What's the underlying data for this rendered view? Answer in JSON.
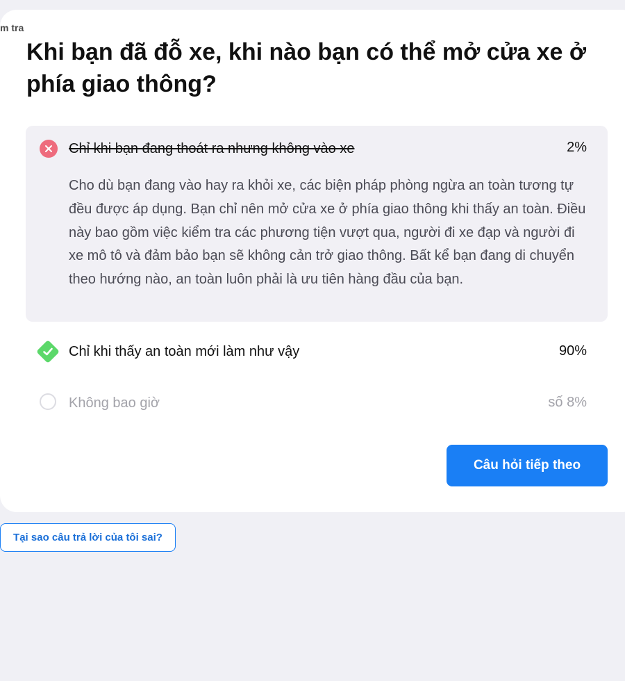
{
  "header": {
    "corner_label": "m tra"
  },
  "question": {
    "text": "Khi bạn đã đỗ xe, khi nào bạn có thể mở cửa xe ở phía giao thông?"
  },
  "answers": [
    {
      "status": "wrong",
      "icon": "x-circle-icon",
      "text": "Chỉ khi bạn đang thoát ra nhưng không vào xe",
      "percent": "2%",
      "explanation": "Cho dù bạn đang vào hay ra khỏi xe, các biện pháp phòng ngừa an toàn tương tự đều được áp dụng. Bạn chỉ nên mở cửa xe ở phía giao thông khi thấy an toàn. Điều này bao gồm việc kiểm tra các phương tiện vượt qua, người đi xe đạp và người đi xe mô tô và đảm bảo bạn sẽ không cản trở giao thông. Bất kể bạn đang di chuyển theo hướng nào, an toàn luôn phải là ưu tiên hàng đầu của bạn."
    },
    {
      "status": "correct",
      "icon": "check-diamond-icon",
      "text": "Chỉ khi thấy an toàn mới làm như vậy",
      "percent": "90%"
    },
    {
      "status": "neutral",
      "icon": "empty-circle-icon",
      "text": "Không bao giờ",
      "percent": "số 8%"
    }
  ],
  "actions": {
    "next_label": "Câu hỏi tiếp theo",
    "why_wrong_label": "Tại sao câu trả lời của tôi sai?"
  },
  "colors": {
    "page_background": "#f0f0f5",
    "card_background": "#ffffff",
    "wrong_answer_background": "#f1f0f5",
    "wrong_icon": "#ee6b7d",
    "correct_icon": "#5cd86a",
    "primary_button": "#1a7ff5",
    "muted_text": "#a3a3aa"
  }
}
